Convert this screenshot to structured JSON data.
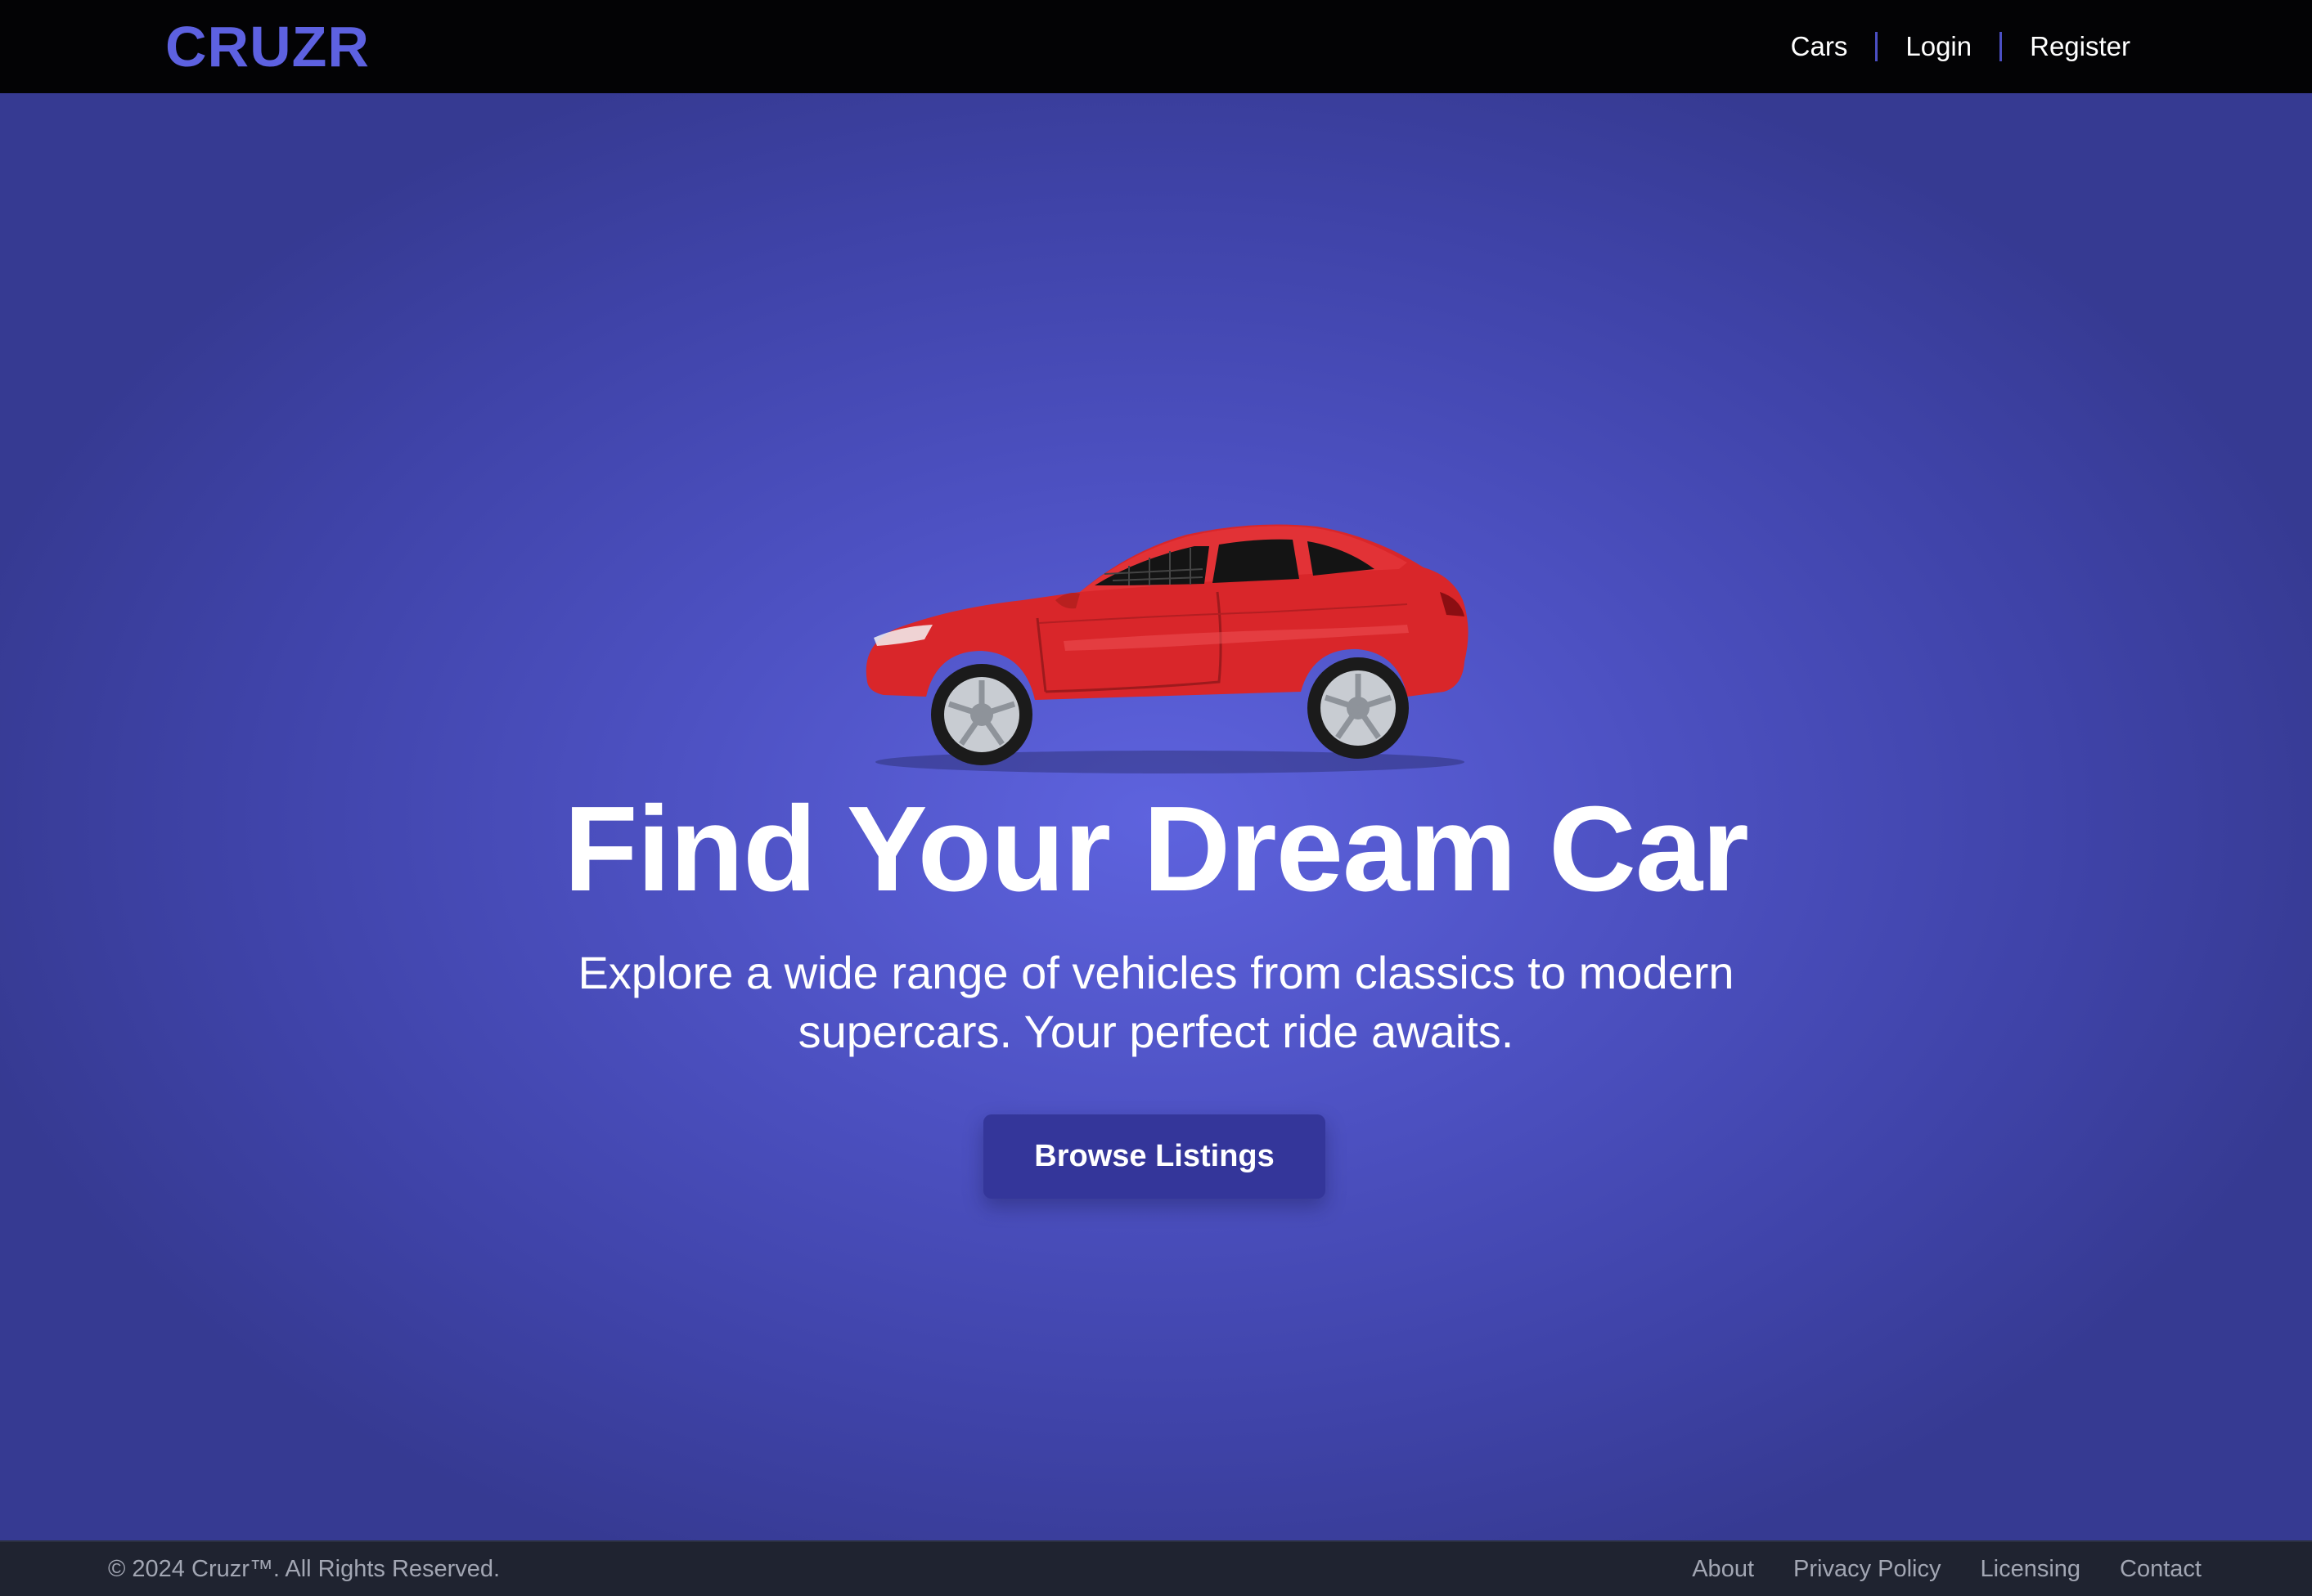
{
  "header": {
    "logo": "CRUZR",
    "nav": [
      {
        "label": "Cars"
      },
      {
        "label": "Login"
      },
      {
        "label": "Register"
      }
    ]
  },
  "hero": {
    "title": "Find Your Dream Car",
    "subtitle": "Explore a wide range of vehicles from classics to modern supercars. Your perfect ride awaits.",
    "cta_label": "Browse Listings",
    "image": "red-coupe-car"
  },
  "footer": {
    "copyright": "© 2024 Cruzr™. All Rights Reserved.",
    "links": [
      {
        "label": "About"
      },
      {
        "label": "Privacy Policy"
      },
      {
        "label": "Licensing"
      },
      {
        "label": "Contact"
      }
    ]
  },
  "colors": {
    "brand": "#5d61e0",
    "nav_bg": "#030305",
    "hero_bg": "#4d51c2",
    "button_bg": "#34369a",
    "footer_bg": "#1f2330",
    "car_body": "#d9262a"
  }
}
